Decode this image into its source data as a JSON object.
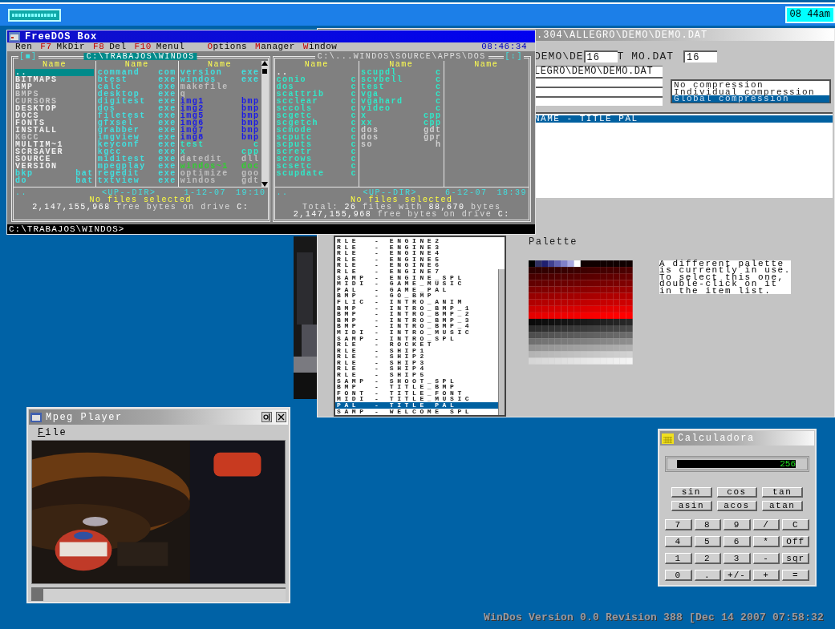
{
  "taskbar": {
    "clock": "08 44am"
  },
  "freedos": {
    "title": "FreeDOS Box",
    "clock": "08:46:34",
    "menu": [
      {
        "kind": "plain",
        "label": "Ren"
      },
      {
        "kind": "fkey",
        "hotkey": "F7",
        "label": "MkDir"
      },
      {
        "kind": "fkey",
        "hotkey": "F8",
        "label": "Del"
      },
      {
        "kind": "fkey",
        "hotkey": "F10",
        "label": "Menul"
      },
      {
        "kind": "letter",
        "hotkey": "O",
        "label": "ptions"
      },
      {
        "kind": "letter",
        "hotkey": "M",
        "label": "anager"
      },
      {
        "kind": "letter",
        "hotkey": "W",
        "label": "indow"
      }
    ],
    "panels": [
      {
        "path": "C:\\TRABAJOS\\WINDOS",
        "marker_left": "[■]",
        "active": true,
        "scrollbar": true,
        "columns": [
          {
            "header": "Name",
            "files": [
              {
                "name": "..",
                "selected": true
              },
              {
                "name": "BITMAPS",
                "color": "#f0f0f0",
                "selected": false
              },
              {
                "name": "BMP",
                "color": "#f0f0f0",
                "selected": false
              },
              {
                "name": "BMPS",
                "color": "#c8c8c8",
                "selected": false
              },
              {
                "name": "CURSORS",
                "color": "#c8c8c8",
                "selected": false
              },
              {
                "name": "DESKTOP",
                "color": "#f0f0f0",
                "selected": false
              },
              {
                "name": "DOCS",
                "color": "#f0f0f0",
                "selected": false
              },
              {
                "name": "FONTS",
                "color": "#f0f0f0",
                "selected": false
              },
              {
                "name": "INSTALL",
                "color": "#f0f0f0",
                "selected": false
              },
              {
                "name": "KGCC",
                "color": "#c8c8c8",
                "selected": false
              },
              {
                "name": "MULTIM~1",
                "color": "#f0f0f0",
                "selected": false
              },
              {
                "name": "SCRSAVER",
                "color": "#f0f0f0",
                "selected": false
              },
              {
                "name": "SOURCE",
                "color": "#f0f0f0",
                "selected": false
              },
              {
                "name": "VERSION",
                "color": "#f0f0f0",
                "selected": false
              },
              {
                "name": "bkp",
                "ext": "bat",
                "color": "#40e0e0",
                "selected": false
              },
              {
                "name": "do",
                "ext": "bat",
                "color": "#40e0e0",
                "selected": false
              }
            ]
          },
          {
            "header": "Name",
            "files": [
              {
                "name": "command",
                "ext": "com",
                "color": "#40e0e0",
                "selected": false
              },
              {
                "name": "btest",
                "ext": "exe",
                "color": "#40e0e0",
                "selected": false
              },
              {
                "name": "calc",
                "ext": "exe",
                "color": "#40e0e0",
                "selected": false
              },
              {
                "name": "desktop",
                "ext": "exe",
                "color": "#40e0e0",
                "selected": false
              },
              {
                "name": "digitest",
                "ext": "exe",
                "color": "#40e0e0",
                "selected": false
              },
              {
                "name": "dos",
                "ext": "exe",
                "color": "#40e0e0",
                "selected": false
              },
              {
                "name": "filetest",
                "ext": "exe",
                "color": "#40e0e0",
                "selected": false
              },
              {
                "name": "gfxsel",
                "ext": "exe",
                "color": "#40e0e0",
                "selected": false
              },
              {
                "name": "grabber",
                "ext": "exe",
                "color": "#40e0e0",
                "selected": false
              },
              {
                "name": "imgview",
                "ext": "exe",
                "color": "#40e0e0",
                "selected": false
              },
              {
                "name": "keyconf",
                "ext": "exe",
                "color": "#40e0e0",
                "selected": false
              },
              {
                "name": "kgcc",
                "ext": "exe",
                "color": "#40e0e0",
                "selected": false
              },
              {
                "name": "miditest",
                "ext": "exe",
                "color": "#40e0e0",
                "selected": false
              },
              {
                "name": "mpegplay",
                "ext": "exe",
                "color": "#40e0e0",
                "selected": false
              },
              {
                "name": "regedit",
                "ext": "exe",
                "color": "#40e0e0",
                "selected": false
              },
              {
                "name": "txtview",
                "ext": "exe",
                "color": "#40e0e0",
                "selected": false
              }
            ]
          },
          {
            "header": "Name",
            "files": [
              {
                "name": "version",
                "ext": "exe",
                "color": "#40e0e0",
                "selected": false
              },
              {
                "name": "windos",
                "ext": "exe",
                "color": "#40e0e0",
                "selected": false
              },
              {
                "name": "makefile",
                "color": "#c0c0c0",
                "selected": false
              },
              {
                "name": "q",
                "color": "#c0c0c0",
                "selected": false
              },
              {
                "name": "img1",
                "ext": "bmp",
                "color": "#1818e8",
                "selected": false
              },
              {
                "name": "img2",
                "ext": "bmp",
                "color": "#1818e8",
                "selected": false
              },
              {
                "name": "img5",
                "ext": "bmp",
                "color": "#1818e8",
                "selected": false
              },
              {
                "name": "img6",
                "ext": "bmp",
                "color": "#1818e8",
                "selected": false
              },
              {
                "name": "img7",
                "ext": "bmp",
                "color": "#1818e8",
                "selected": false
              },
              {
                "name": "img8",
                "ext": "bmp",
                "color": "#1818e8",
                "selected": false
              },
              {
                "name": "test",
                "ext": "c",
                "color": "#30e8c8",
                "selected": false
              },
              {
                "name": "x",
                "ext": "cpp",
                "color": "#30e8c8",
                "selected": false
              },
              {
                "name": "datedit",
                "ext": "dll",
                "color": "#c0c0c0",
                "selected": false
              },
              {
                "name": "windos~1",
                "ext": "doc",
                "color": "#30d030",
                "selected": false
              },
              {
                "name": "optimize",
                "ext": "goo",
                "color": "#c0c0c0",
                "selected": false
              },
              {
                "name": "windos",
                "ext": "gdt",
                "color": "#c0c0c0",
                "selected": false
              }
            ]
          }
        ],
        "footer": {
          "up": {
            "name": "..",
            "label": "<UP--DIR>",
            "date": "1-12-07",
            "time": "19:10"
          },
          "selection": "No files selected",
          "free": [
            {
              "kind": "value",
              "text": "2,147,155,968"
            },
            {
              "kind": "label",
              "text": "free bytes on drive"
            },
            {
              "kind": "value",
              "text": "C:"
            }
          ]
        }
      },
      {
        "path": "C:\\...WINDOS\\SOURCE\\APPS\\DOS",
        "marker_right": "[↕]",
        "active": false,
        "scrollbar": false,
        "columns": [
          {
            "header": "Name",
            "files": [
              {
                "name": "..",
                "selected": false
              },
              {
                "name": "conio",
                "ext": "c",
                "color": "#30e8c8",
                "selected": false
              },
              {
                "name": "dos",
                "ext": "c",
                "color": "#30e8c8",
                "selected": false
              },
              {
                "name": "scattrib",
                "ext": "c",
                "color": "#30e8c8",
                "selected": false
              },
              {
                "name": "scclear",
                "ext": "c",
                "color": "#30e8c8",
                "selected": false
              },
              {
                "name": "sccols",
                "ext": "c",
                "color": "#30e8c8",
                "selected": false
              },
              {
                "name": "scgetc",
                "ext": "c",
                "color": "#30e8c8",
                "selected": false
              },
              {
                "name": "scgetch",
                "ext": "c",
                "color": "#30e8c8",
                "selected": false
              },
              {
                "name": "scmode",
                "ext": "c",
                "color": "#30e8c8",
                "selected": false
              },
              {
                "name": "scputc",
                "ext": "c",
                "color": "#30e8c8",
                "selected": false
              },
              {
                "name": "scputs",
                "ext": "c",
                "color": "#30e8c8",
                "selected": false
              },
              {
                "name": "scretr",
                "ext": "c",
                "color": "#30e8c8",
                "selected": false
              },
              {
                "name": "scrows",
                "ext": "c",
                "color": "#30e8c8",
                "selected": false
              },
              {
                "name": "scsetc",
                "ext": "c",
                "color": "#30e8c8",
                "selected": false
              },
              {
                "name": "scupdate",
                "ext": "c",
                "color": "#30e8c8",
                "selected": false
              }
            ]
          },
          {
            "header": "Name",
            "files": [
              {
                "name": "scupdl",
                "ext": "c",
                "color": "#30e8c8",
                "selected": false
              },
              {
                "name": "scvbell",
                "ext": "c",
                "color": "#30e8c8",
                "selected": false
              },
              {
                "name": "test",
                "ext": "c",
                "color": "#30e8c8",
                "selected": false
              },
              {
                "name": "vga",
                "ext": "c",
                "color": "#30e8c8",
                "selected": false
              },
              {
                "name": "vgahard",
                "ext": "c",
                "color": "#30e8c8",
                "selected": false
              },
              {
                "name": "video",
                "ext": "c",
                "color": "#30e8c8",
                "selected": false
              },
              {
                "name": "x",
                "ext": "cpp",
                "color": "#30e8c8",
                "selected": false
              },
              {
                "name": "xx",
                "ext": "cpp",
                "color": "#30e8c8",
                "selected": false
              },
              {
                "name": "dos",
                "ext": "gdt",
                "color": "#d0d0d0",
                "selected": false
              },
              {
                "name": "dos",
                "ext": "gpr",
                "color": "#d0d0d0",
                "selected": false
              },
              {
                "name": "so",
                "ext": "h",
                "color": "#d0d0d0",
                "selected": false
              }
            ]
          },
          {
            "header": "Name"
          }
        ],
        "footer": {
          "up": {
            "name": "..",
            "label": "<UP--DIR>",
            "date": "6-12-07",
            "time": "18:39"
          },
          "selection": "No files selected",
          "total": [
            {
              "kind": "label",
              "text": "Total:"
            },
            {
              "kind": "value",
              "text": "26"
            },
            {
              "kind": "label",
              "text": "files with"
            },
            {
              "kind": "value",
              "text": "88,670"
            },
            {
              "kind": "label",
              "text": "bytes"
            }
          ],
          "free": [
            {
              "kind": "value",
              "text": "2,147,155,968"
            },
            {
              "kind": "label",
              "text": "free bytes on drive"
            },
            {
              "kind": "value",
              "text": "C:"
            }
          ]
        }
      }
    ],
    "command_line": "C:\\TRABAJOS\\WINDOS>"
  },
  "grabber": {
    "title": ".304\\ALLEGRO\\DEMO\\DEMO.DAT",
    "header_row": [
      {
        "kind": "text",
        "text": "DEMO\\DE"
      },
      {
        "kind": "field",
        "value": "16"
      },
      {
        "kind": "text",
        "text": "T MO.DAT"
      },
      {
        "kind": "field",
        "value": "16"
      }
    ],
    "path_field": "LEGRO\\DEMO\\DEMO.DAT",
    "compression": [
      {
        "label": "No compression",
        "selected": false
      },
      {
        "label": "Individual compression",
        "selected": false
      },
      {
        "label": "Global compression",
        "selected": true
      }
    ],
    "properties": [
      {
        "text": "NAME - TITLE PAL",
        "selected": true
      }
    ],
    "objects": [
      {
        "text": "RLE  - ENGINE2",
        "selected": false
      },
      {
        "text": "RLE  - ENGINE3",
        "selected": false
      },
      {
        "text": "RLE  - ENGINE4",
        "selected": false
      },
      {
        "text": "RLE  - ENGINE5",
        "selected": false
      },
      {
        "text": "RLE  - ENGINE6",
        "selected": false
      },
      {
        "text": "RLE  - ENGINE7",
        "selected": false
      },
      {
        "text": "SAMP - ENGINE_SPL",
        "selected": false
      },
      {
        "text": "MIDI - GAME_MUSIC",
        "selected": false
      },
      {
        "text": "PAL  - GAME_PAL",
        "selected": false
      },
      {
        "text": "BMP  - GO_BMP",
        "selected": false
      },
      {
        "text": "FLIC - INTRO_ANIM",
        "selected": false
      },
      {
        "text": "BMP  - INTRO_BMP_1",
        "selected": false
      },
      {
        "text": "BMP  - INTRO_BMP_2",
        "selected": false
      },
      {
        "text": "BMP  - INTRO_BMP_3",
        "selected": false
      },
      {
        "text": "BMP  - INTRO_BMP_4",
        "selected": false
      },
      {
        "text": "MIDI - INTRO_MUSIC",
        "selected": false
      },
      {
        "text": "SAMP - INTRO_SPL",
        "selected": false
      },
      {
        "text": "RLE  - ROCKET",
        "selected": false
      },
      {
        "text": "RLE  - SHIP1",
        "selected": false
      },
      {
        "text": "RLE  - SHIP2",
        "selected": false
      },
      {
        "text": "RLE  - SHIP3",
        "selected": false
      },
      {
        "text": "RLE  - SHIP4",
        "selected": false
      },
      {
        "text": "RLE  - SHIP5",
        "selected": false
      },
      {
        "text": "SAMP - SHOOT_SPL",
        "selected": false
      },
      {
        "text": "BMP  - TITLE_BMP",
        "selected": false
      },
      {
        "text": "FONT - TITLE_FONT",
        "selected": false
      },
      {
        "text": "MIDI - TITLE_MUSIC",
        "selected": false
      },
      {
        "text": "PAL  - TITLE PAL",
        "selected": true
      },
      {
        "text": "SAMP - WELCOME SPL",
        "selected": false
      }
    ],
    "palette_label": "Palette",
    "palette_note": [
      "A different palette",
      "is currently in use.",
      "To select this one,",
      "double-click on it",
      "in the item list."
    ]
  },
  "mpeg_player": {
    "title": "Mpeg Player",
    "menu": [
      {
        "hotkey": "F",
        "rest": "ile"
      }
    ],
    "progress": {
      "level": 0.04
    }
  },
  "calculator": {
    "title": "Calculadora",
    "display": "256",
    "functions": [
      "sin",
      "cos",
      "tan",
      "asin",
      "acos",
      "atan"
    ],
    "keys": [
      "7",
      "8",
      "9",
      "/",
      "C",
      "4",
      "5",
      "6",
      "*",
      "Off",
      "1",
      "2",
      "3",
      "-",
      "sqr",
      "0",
      ".",
      "+/-",
      "+",
      "="
    ]
  },
  "version": "WinDos Version 0.0 Revision 388 [Dec 14 2007 07:58:32"
}
